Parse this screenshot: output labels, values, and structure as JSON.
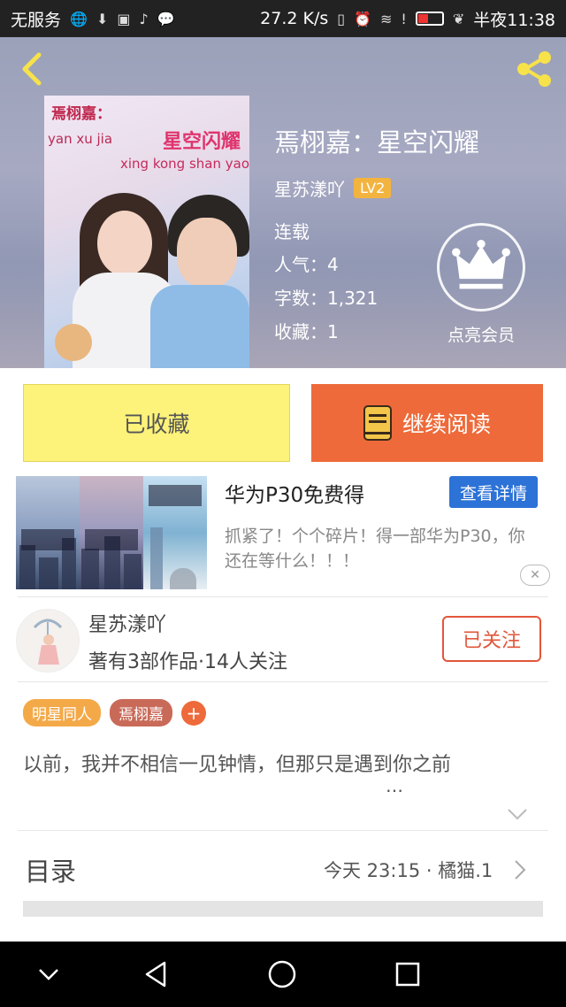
{
  "status_bar": {
    "carrier": "无服务",
    "speed": "27.2 K/s",
    "time": "半夜11:38"
  },
  "book": {
    "title": "焉栩嘉：星空闪耀",
    "author": "星苏漾吖",
    "level": "LV2",
    "status": "连载",
    "popularity": "人气：4",
    "word_count": "字数：1,321",
    "favorites": "收藏：1",
    "vip_label": "点亮会员",
    "cover": {
      "title_a": "焉栩嘉：",
      "pinyin_a": "yan xu jia",
      "title_b": "星空闪耀",
      "pinyin_b": "xing kong shan yao"
    }
  },
  "actions": {
    "collected_label": "已收藏",
    "continue_label": "继续阅读"
  },
  "ad": {
    "title": "华为P30免费得",
    "detail_label": "查看详情",
    "description": "抓紧了！个个碎片！得一部华为P30，你还在等什么！！！",
    "close_label": "✕"
  },
  "author_card": {
    "name": "星苏漾吖",
    "stats": "著有3部作品·14人关注",
    "follow_label": "已关注"
  },
  "tags": [
    "明星同人",
    "焉栩嘉"
  ],
  "tag_add": "+",
  "synopsis": "以前，我并不相信一见钟情，但那只是遇到你之前",
  "synopsis_more": "…",
  "toc": {
    "label": "目录",
    "update": "今天 23:15 · 橘猫.1"
  },
  "icons": {
    "back": "back-arrow-icon",
    "share": "share-icon",
    "crown": "crown-icon",
    "book": "book-icon",
    "chevron": "chevron-right-icon"
  },
  "colors": {
    "read_button": "#ee6a3a",
    "collected_button": "#fdf27a",
    "level_badge": "#f3b43f",
    "follow_border": "#e1573a",
    "detail_button": "#2c72d7"
  }
}
